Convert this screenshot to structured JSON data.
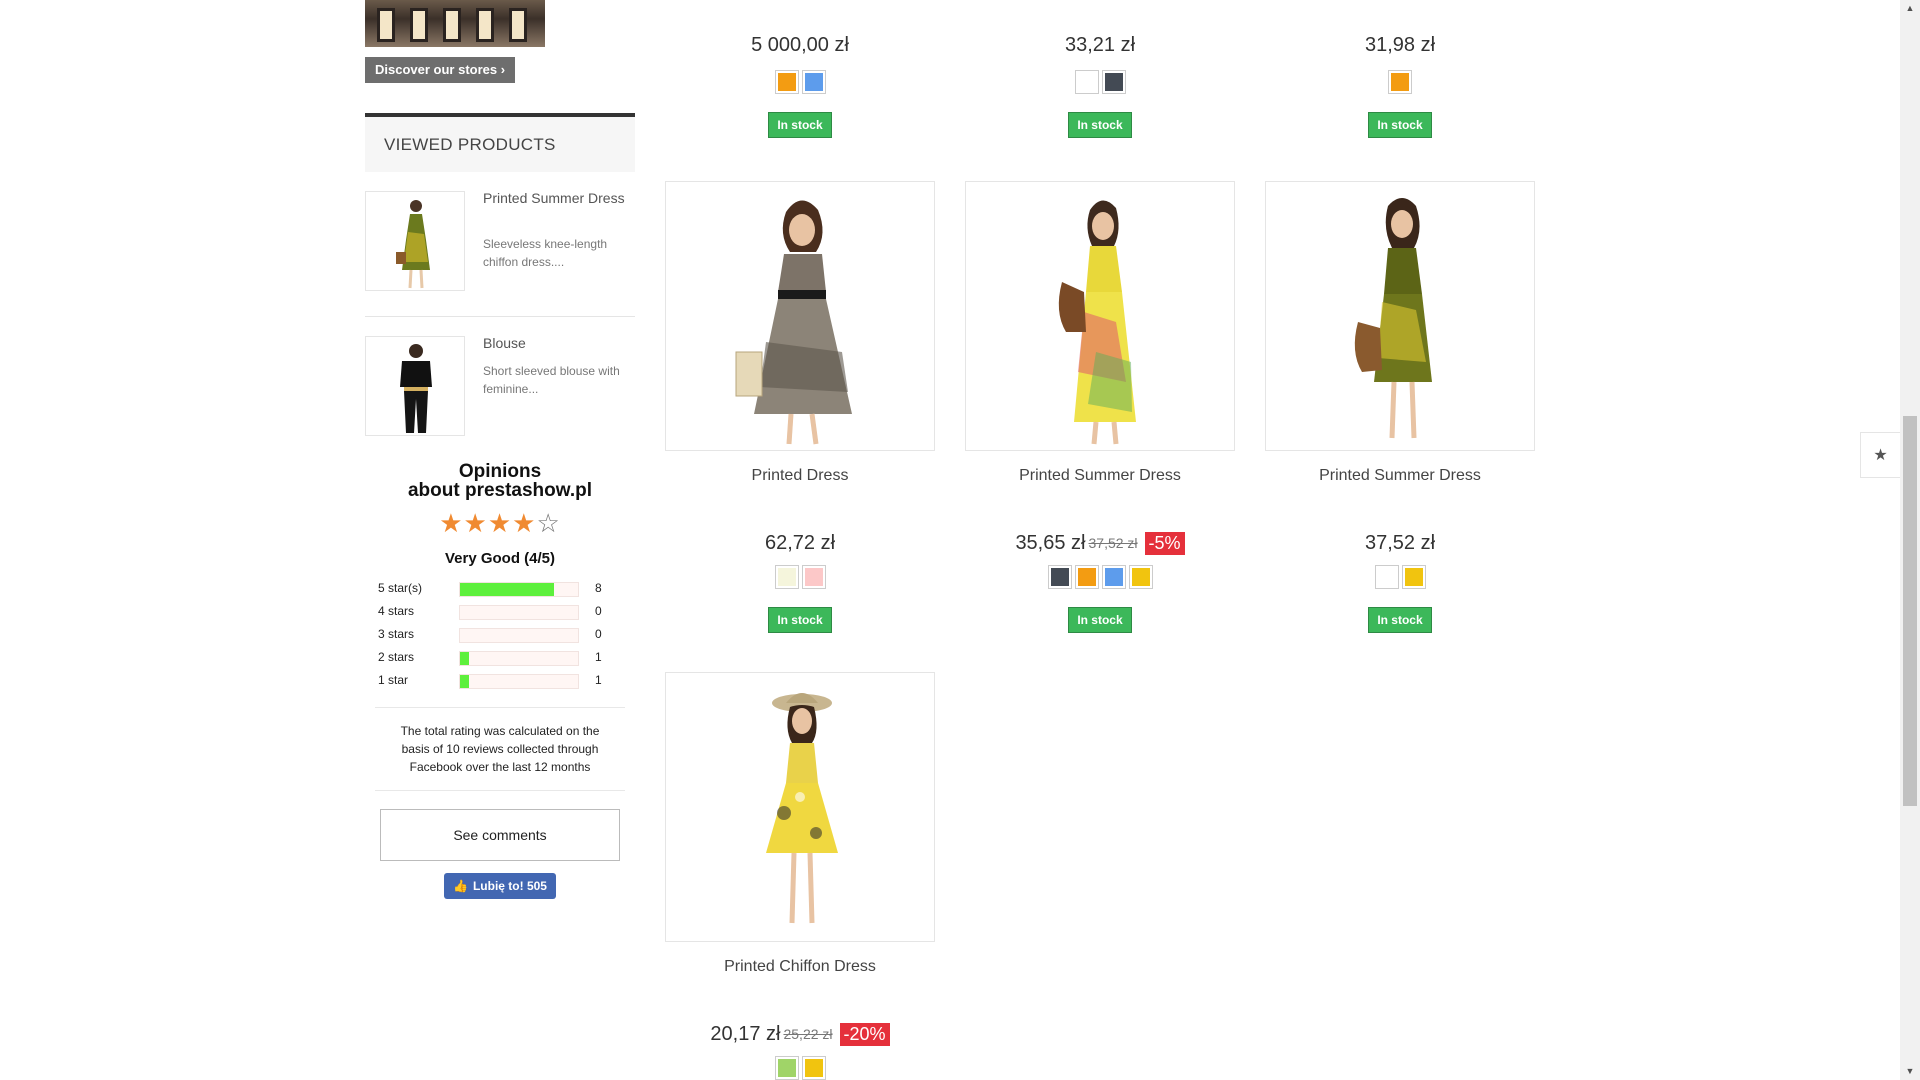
{
  "sidebar": {
    "stores_button": "Discover our stores",
    "viewed": {
      "title": "VIEWED PRODUCTS",
      "items": [
        {
          "name": "Printed Summer Dress",
          "desc": "Sleeveless knee-length chiffon dress...."
        },
        {
          "name": "Blouse",
          "desc": "Short sleeved blouse with feminine..."
        }
      ]
    },
    "opinions": {
      "title_line1": "Opinions",
      "title_line2": "about prestashow.pl",
      "stars_full": "★★★★",
      "stars_empty": "☆",
      "rating_text": "Very Good (4/5)",
      "distribution": [
        {
          "label": "5 star(s)",
          "count": "8",
          "fraction": 0.8
        },
        {
          "label": "4 stars",
          "count": "0",
          "fraction": 0
        },
        {
          "label": "3 stars",
          "count": "0",
          "fraction": 0
        },
        {
          "label": "2 stars",
          "count": "1",
          "fraction": 0.08
        },
        {
          "label": "1 star",
          "count": "1",
          "fraction": 0.08
        }
      ],
      "note": "The total rating was calculated on the basis of  10 reviews collected through Facebook over the last 12 months",
      "see_comments": "See comments",
      "fb_like": "Lubię to! 505"
    }
  },
  "top_row": [
    {
      "price": "5 000,00 zł",
      "swatches": [
        "#f39c12",
        "#5d9cec"
      ],
      "stock": "In stock"
    },
    {
      "price": "33,21 zł",
      "swatches": [
        "#ffffff",
        "#434a54"
      ],
      "stock": "In stock"
    },
    {
      "price": "31,98 zł",
      "swatches": [
        "#f39c12"
      ],
      "stock": "In stock"
    }
  ],
  "products": [
    {
      "name": "Printed Dress",
      "price": "62,72 zł",
      "old_price": "",
      "discount": "",
      "swatches": [
        "#f5f5dc",
        "#fcc8c8"
      ],
      "stock": "In stock"
    },
    {
      "name": "Printed Summer Dress",
      "price": "35,65 zł",
      "old_price": "37,52 zł",
      "discount": "-5%",
      "swatches": [
        "#434a54",
        "#f39c12",
        "#5d9cec",
        "#f1c40f"
      ],
      "stock": "In stock"
    },
    {
      "name": "Printed Summer Dress",
      "price": "37,52 zł",
      "old_price": "",
      "discount": "",
      "swatches": [
        "#ffffff",
        "#f1c40f"
      ],
      "stock": "In stock"
    },
    {
      "name": "Printed Chiffon Dress",
      "price": "20,17 zł",
      "old_price": "25,22 zł",
      "discount": "-20%",
      "swatches": [
        "#a0d468",
        "#f1c40f"
      ],
      "stock": ""
    }
  ]
}
